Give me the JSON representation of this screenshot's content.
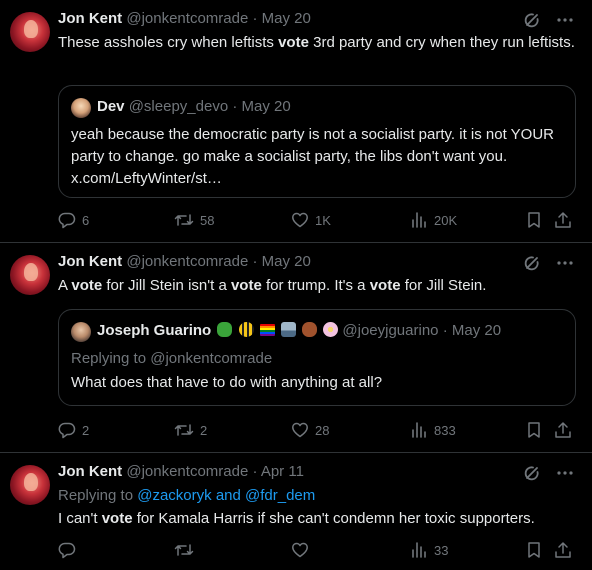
{
  "tweets": [
    {
      "name": "Jon Kent",
      "handle": "@jonkentcomrade",
      "separator": "·",
      "date": "May 20",
      "text_parts": [
        "These assholes cry when leftists ",
        "vote",
        " 3rd party and cry when they run leftists."
      ],
      "quote": {
        "name": "Dev",
        "handle": "@sleepy_devo",
        "separator": "·",
        "date": "May 20",
        "text": "yeah because the democratic party is not a socialist party. it is not YOUR party to change. go make a socialist party, the libs don't want you. x.com/LeftyWinter/st…"
      },
      "stats": {
        "replies": "6",
        "reposts": "58",
        "likes": "1K",
        "views": "20K"
      }
    },
    {
      "name": "Jon Kent",
      "handle": "@jonkentcomrade",
      "separator": "·",
      "date": "May 20",
      "text_parts": [
        "A ",
        "vote",
        " for Jill Stein isn't a ",
        "vote",
        " for trump. It's a ",
        "vote",
        " for Jill Stein."
      ],
      "quote": {
        "name": "Joseph Guarino",
        "handle": "@joeyjguarino",
        "separator": "·",
        "date": "May 20",
        "replying_prefix": "Replying to",
        "replying_handle": "@jonkentcomrade",
        "text": "What does that have to do with anything at all?"
      },
      "stats": {
        "replies": "2",
        "reposts": "2",
        "likes": "28",
        "views": "833"
      }
    },
    {
      "name": "Jon Kent",
      "handle": "@jonkentcomrade",
      "separator": "·",
      "date": "Apr 11",
      "replying_prefix": "Replying to",
      "replying_handle_1": "@zackoryk",
      "replying_and": "and",
      "replying_handle_2": "@fdr_dem",
      "text_parts": [
        "I can't ",
        "vote",
        " for Kamala Harris if she can't condemn her toxic supporters."
      ],
      "stats": {
        "replies": "",
        "reposts": "",
        "likes": "",
        "views": "33"
      }
    }
  ],
  "icons": {
    "grok": "grok-icon",
    "more": "more-icon",
    "reply": "reply-icon",
    "repost": "repost-icon",
    "like": "like-icon",
    "views": "views-icon",
    "bookmark": "bookmark-icon",
    "share": "share-icon"
  },
  "colors": {
    "background": "#000000",
    "text": "#e7e9ea",
    "muted": "#71767b",
    "link": "#1d9bf0",
    "border": "#2f3336"
  }
}
